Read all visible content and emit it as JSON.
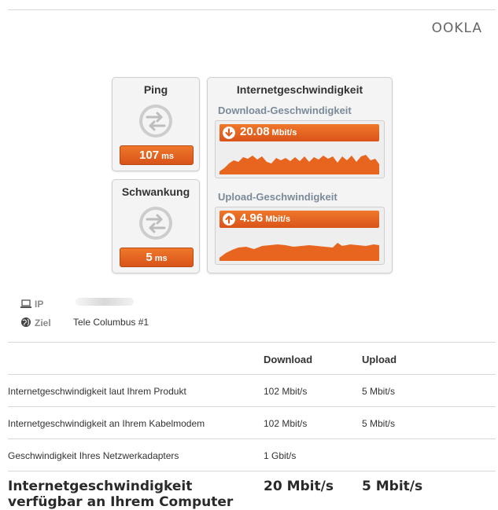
{
  "brand": {
    "logo": "OOKLA"
  },
  "ping": {
    "title": "Ping",
    "value": "107",
    "unit": "ms",
    "icon": "ping-arrows-icon"
  },
  "jitter": {
    "title": "Schwankung",
    "value": "5",
    "unit": "ms",
    "icon": "jitter-arrows-icon"
  },
  "speed": {
    "title": "Internetgeschwindigkeit",
    "download": {
      "label": "Download-Geschwindigkeit",
      "value": "20.08",
      "unit": "Mbit/s",
      "icon": "arrow-down-icon"
    },
    "upload": {
      "label": "Upload-Geschwindigkeit",
      "value": "4.96",
      "unit": "Mbit/s",
      "icon": "arrow-up-icon"
    }
  },
  "info": {
    "ip_label": "IP",
    "ip_icon": "laptop-icon",
    "ziel_label": "Ziel",
    "ziel_icon": "globe-icon",
    "ziel_value": "Tele Columbus #1"
  },
  "table": {
    "headers": [
      "Download",
      "Upload"
    ],
    "rows": [
      {
        "label": "Internetgeschwindigkeit laut Ihrem Produkt",
        "download": "102 Mbit/s",
        "upload": "5 Mbit/s"
      },
      {
        "label": "Internetgeschwindigkeit an Ihrem Kabelmodem",
        "download": "102 Mbit/s",
        "upload": "5 Mbit/s"
      },
      {
        "label": "Geschwindigkeit Ihres Netzwerkadapters",
        "download": "1 Gbit/s",
        "upload": ""
      }
    ],
    "final": {
      "label_line1": "Internetgeschwindigkeit",
      "label_line2": "verfügbar an Ihrem Computer",
      "download": "20 Mbit/s",
      "upload": "5 Mbit/s"
    }
  },
  "colors": {
    "accent": "#e8651f",
    "graph": "#e8651f",
    "card_bg": "#f4f4f4"
  }
}
